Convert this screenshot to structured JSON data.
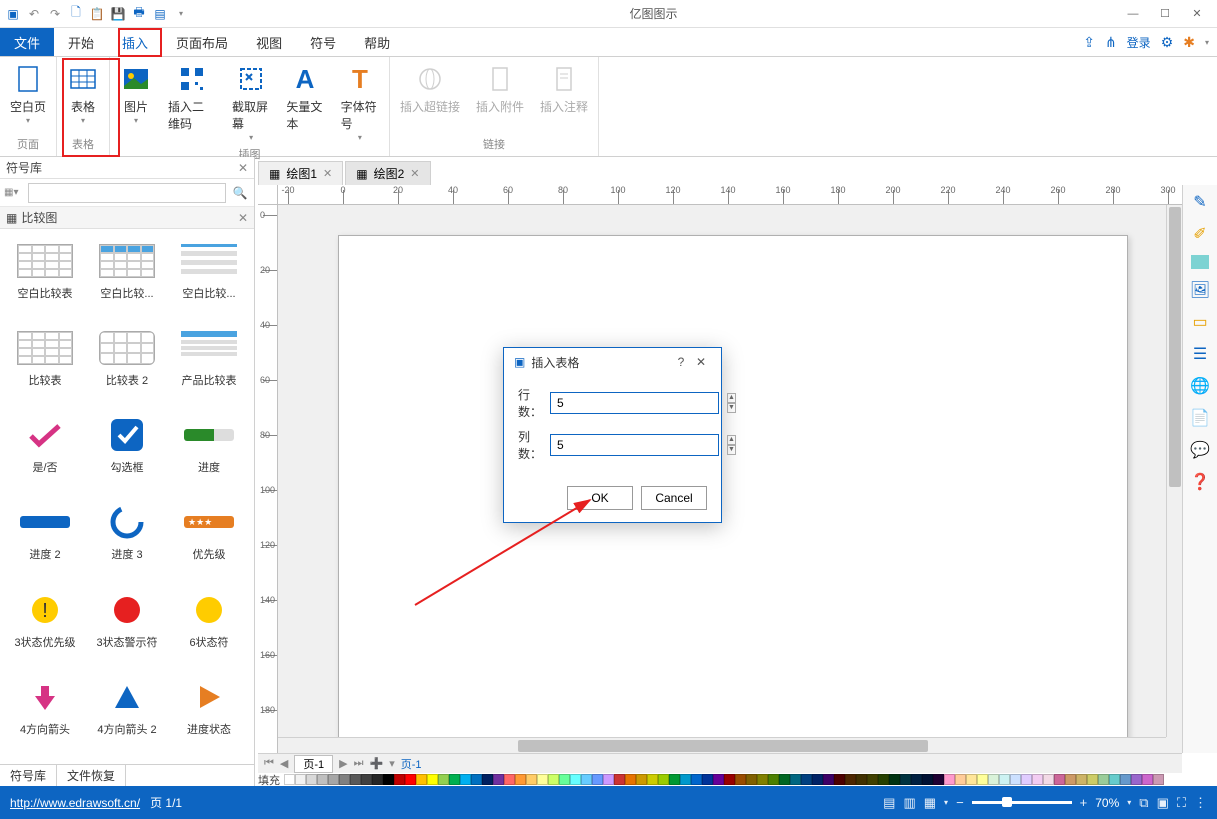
{
  "app_title": "亿图图示",
  "qat": [
    "logo",
    "undo",
    "redo",
    "new",
    "paste",
    "save",
    "print",
    "export"
  ],
  "win": {
    "min": "—",
    "max": "☐",
    "close": "✕"
  },
  "menu": {
    "file": "文件",
    "home": "开始",
    "insert": "插入",
    "layout": "页面布局",
    "view": "视图",
    "symbol": "符号",
    "help": "帮助"
  },
  "menu_right": {
    "share": "↗",
    "link": "⚓",
    "login": "登录",
    "gear": "⚙",
    "grid": "⊞"
  },
  "ribbon": {
    "page": {
      "blank": "空白页",
      "group": "页面"
    },
    "table": {
      "btn": "表格",
      "group": "表格"
    },
    "illus": {
      "pic": "图片",
      "qr": "插入二维码",
      "shot": "截取屏幕",
      "vec": "矢量文本",
      "font": "字体符号",
      "group": "插图"
    },
    "link": {
      "hyper": "插入超链接",
      "attach": "插入附件",
      "comment": "插入注释",
      "group": "链接"
    }
  },
  "leftpanel": {
    "title": "符号库",
    "cat": "比较图",
    "items": [
      {
        "name": "空白比较表"
      },
      {
        "name": "空白比较..."
      },
      {
        "name": "空白比较..."
      },
      {
        "name": "比较表"
      },
      {
        "name": "比较表 2"
      },
      {
        "name": "产品比较表"
      },
      {
        "name": "是/否"
      },
      {
        "name": "勾选框"
      },
      {
        "name": "进度"
      },
      {
        "name": "进度 2"
      },
      {
        "name": "进度 3"
      },
      {
        "name": "优先级"
      },
      {
        "name": "3状态优先级"
      },
      {
        "name": "3状态警示符"
      },
      {
        "name": "6状态符"
      },
      {
        "name": "4方向箭头"
      },
      {
        "name": "4方向箭头 2"
      },
      {
        "name": "进度状态"
      }
    ],
    "tabs": [
      "符号库",
      "文件恢复"
    ]
  },
  "doctabs": [
    {
      "label": "绘图1",
      "active": false
    },
    {
      "label": "绘图2",
      "active": true
    }
  ],
  "ruler_h": [
    "-20",
    "0",
    "20",
    "40",
    "60",
    "80",
    "100",
    "120",
    "140",
    "160",
    "180",
    "200",
    "220",
    "240",
    "260",
    "280",
    "300"
  ],
  "ruler_v": [
    "0",
    "20",
    "40",
    "60",
    "80",
    "100",
    "120",
    "140",
    "160",
    "180"
  ],
  "dialog": {
    "title": "插入表格",
    "rows_label": "行数：",
    "rows_val": "5",
    "cols_label": "列数：",
    "cols_val": "5",
    "ok": "OK",
    "cancel": "Cancel"
  },
  "pagebar": {
    "current": "页-1",
    "label": "页-1"
  },
  "fill_label": "填充",
  "status": {
    "url": "http://www.edrawsoft.cn/",
    "page": "页 1/1",
    "zoom": "70%"
  },
  "colors": [
    "#ffffff",
    "#f2f2f2",
    "#d9d9d9",
    "#bfbfbf",
    "#a6a6a6",
    "#808080",
    "#595959",
    "#404040",
    "#262626",
    "#000000",
    "#c00000",
    "#ff0000",
    "#ffc000",
    "#ffff00",
    "#92d050",
    "#00b050",
    "#00b0f0",
    "#0070c0",
    "#002060",
    "#7030a0",
    "#ff6666",
    "#ff9933",
    "#ffcc66",
    "#ffff99",
    "#ccff66",
    "#66ff99",
    "#66ffff",
    "#66ccff",
    "#6699ff",
    "#cc99ff",
    "#cc3333",
    "#e67300",
    "#cc9900",
    "#cccc00",
    "#99cc00",
    "#009933",
    "#0099cc",
    "#0066cc",
    "#003399",
    "#660099",
    "#990000",
    "#994c00",
    "#806000",
    "#808000",
    "#4c8000",
    "#006622",
    "#006680",
    "#004080",
    "#002266",
    "#3d0066",
    "#4d0000",
    "#4d2600",
    "#403000",
    "#404000",
    "#264000",
    "#003311",
    "#003340",
    "#002040",
    "#001133",
    "#1f0033",
    "#ff99cc",
    "#ffcc99",
    "#ffe699",
    "#ffff99",
    "#d9f2d9",
    "#ccf2f2",
    "#cce0ff",
    "#e0ccff",
    "#f2ccf2",
    "#f2d9e6",
    "#cc6699",
    "#cc9966",
    "#ccb366",
    "#cccc66",
    "#99cc99",
    "#66cccc",
    "#6699cc",
    "#9966cc",
    "#cc66cc",
    "#cc99b3"
  ]
}
